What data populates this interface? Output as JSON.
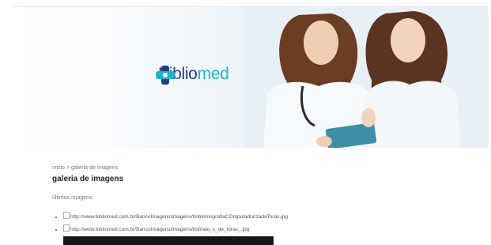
{
  "brand": {
    "name_main": "Biblio",
    "name_accent": "med"
  },
  "breadcrumb": {
    "home": "inicio",
    "separator": ">",
    "current": "galeria de imagens"
  },
  "page": {
    "title": "galeria de imagens",
    "section_label": "últimos imagens"
  },
  "images": [
    {
      "alt": "http://www.bibliomed.com.br/BancoImagens/imagens/tmblomografiaCOmputadorizadaTorax.jpg"
    },
    {
      "alt": "http://www.bibliomed.com.br/BancoImagens/imagens/tmbraio_x_de_torax_.jpg"
    }
  ],
  "colors": {
    "brand_dark": "#1f3f7a",
    "brand_accent": "#1fb3c9"
  }
}
